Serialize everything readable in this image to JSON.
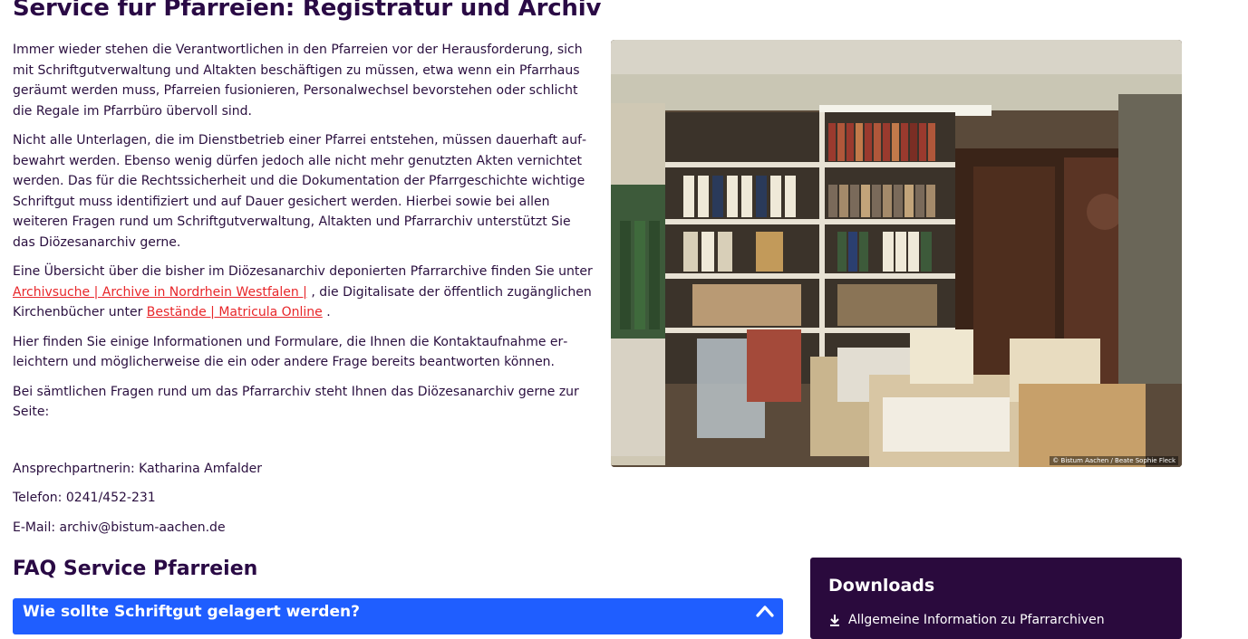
{
  "page": {
    "title": "Service für Pfarreien: Registratur und Archiv"
  },
  "intro": {
    "p1": "Immer wieder stehen die Verantwortlichen in den Pfarreien vor der Herausforderung, sich mit Schriftgutverwaltung und Altakten beschäftigen zu müssen, etwa wenn ein Pfarrhaus geräumt werden muss, Pfarreien fusionieren, Personalwechsel bevorstehen oder schlicht die Regale im Pfarrbüro übervoll sind.",
    "p2": "Nicht alle Unterlagen, die im Dienstbetrieb einer Pfarrei entstehen, müssen dauerhaft auf­bewahrt werden. Ebenso wenig dürfen jedoch alle nicht mehr genutzten Akten vernichtet werden. Das für die Rechtssicherheit und die Dokumentation der Pfarrgeschichte wichtige Schriftgut muss identifiziert und auf Dauer gesichert werden. Hierbei sowie bei allen weite­ren Fragen rund um Schriftgutverwaltung, Altakten und Pfarrarchiv unterstützt Sie das Diö­zesanarchiv gerne.",
    "p3_before": "Eine Übersicht über die bisher im Diözesanarchiv deponierten Pfarrarchive finden Sie unter ",
    "p3_link1": "Archivsuche | Archive in Nordrhein Westfalen |",
    "p3_middle": " , die Digitalisate der öffentlich zugänglichen Kirchenbücher unter ",
    "p3_link2": "Bestände | Matricula Online",
    "p3_after": " .",
    "p4": "Hier finden Sie einige Informationen und Formulare, die Ihnen die Kontaktaufnahme er­leichtern und möglicherweise die ein oder andere Frage bereits beantworten können.",
    "p5": "Bei sämtlichen Fragen rund um das Pfarrarchiv steht Ihnen das Diözesanarchiv gerne zur Seite:"
  },
  "contact": {
    "person": "Ansprechpartnerin: Katharina Amfalder",
    "phone": "Telefon: 0241/452-231",
    "email": "E-Mail: archiv@bistum-aachen.de"
  },
  "image": {
    "credit": "© Bistum Aachen / Beate Sophie Fleck"
  },
  "faq": {
    "title": "FAQ Service Pfarreien",
    "item1": "Wie sollte Schriftgut gelagert werden?",
    "expand_icon": "chevron-up-icon"
  },
  "downloads": {
    "title": "Downloads",
    "item1": "Allgemeine Information zu Pfarrarchiven",
    "icon": "download-icon"
  },
  "colors": {
    "heading": "#2a0a45",
    "link": "#e8262a",
    "accordion": "#1f5eff",
    "downloads_bg": "#2a0a3d"
  }
}
